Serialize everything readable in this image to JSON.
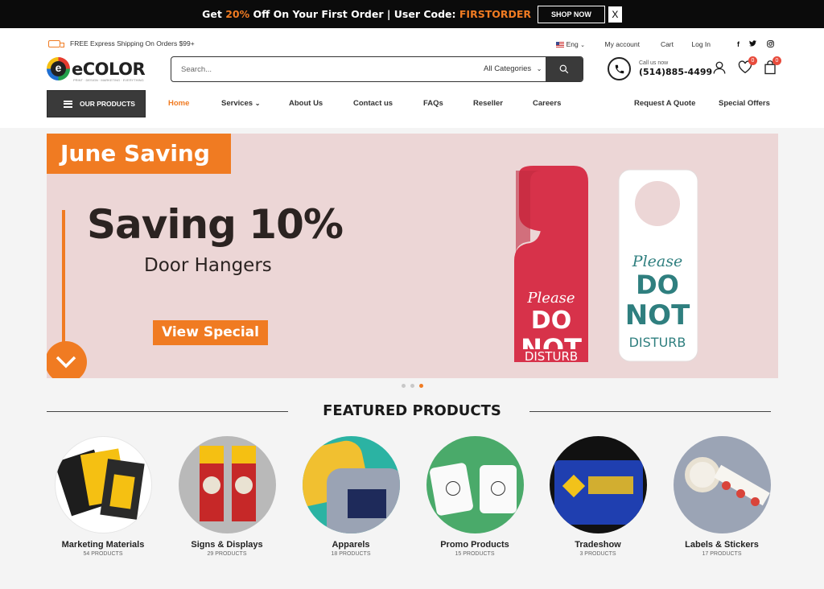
{
  "promo": {
    "text_before": "Get ",
    "discount": "20%",
    "text_middle": " Off On Your First Order | User Code: ",
    "code": "FIRSTORDER",
    "button": "SHOP NOW",
    "close": "X"
  },
  "topbar": {
    "shipping": "FREE Express Shipping On Orders $99+",
    "language": "Eng",
    "my_account": "My account",
    "cart": "Cart",
    "login": "Log In"
  },
  "logo": {
    "text": "eCOLOR",
    "tagline": "PRINT · DESIGN · MARKETING · EVERYTHING"
  },
  "search": {
    "placeholder": "Search...",
    "category": "All Categories"
  },
  "contact": {
    "label": "Call us now",
    "phone": "(514)885-4499"
  },
  "counts": {
    "wishlist": "0",
    "cart": "0"
  },
  "nav": {
    "our_products": "OUR PRODUCTS",
    "home": "Home",
    "services": "Services",
    "about": "About Us",
    "contact": "Contact us",
    "faqs": "FAQs",
    "reseller": "Reseller",
    "careers": "Careers",
    "quote": "Request A Quote",
    "offers": "Special Offers"
  },
  "banner": {
    "tag": "June Saving",
    "headline": "Saving 10%",
    "subheadline": "Door Hangers",
    "button": "View Special",
    "hanger_text": {
      "line1": "Please",
      "line2": "DO",
      "line3": "NOT",
      "line4": "DISTURB"
    }
  },
  "carousel": {
    "slides": 3,
    "active": 3
  },
  "featured": {
    "title": "FEATURED PRODUCTS",
    "items": [
      {
        "name": "Marketing Materials",
        "count": "54 PRODUCTS"
      },
      {
        "name": "Signs & Displays",
        "count": "29 PRODUCTS"
      },
      {
        "name": "Apparels",
        "count": "18 PRODUCTS"
      },
      {
        "name": "Promo Products",
        "count": "15 PRODUCTS"
      },
      {
        "name": "Tradeshow",
        "count": "3 PRODUCTS"
      },
      {
        "name": "Labels & Stickers",
        "count": "17 PRODUCTS"
      }
    ]
  },
  "colors": {
    "accent": "#f07b22",
    "dark": "#3a3a3a",
    "banner_bg": "#ecd6d6",
    "hanger_red": "#d7324a",
    "hanger_teal": "#2f7f7f"
  },
  "icons": [
    "truck-icon",
    "chevron-down-icon",
    "facebook-icon",
    "twitter-icon",
    "instagram-icon",
    "search-icon",
    "phone-icon",
    "user-icon",
    "heart-icon",
    "shopping-bag-icon",
    "menu-icon",
    "chevron-down-icon"
  ]
}
